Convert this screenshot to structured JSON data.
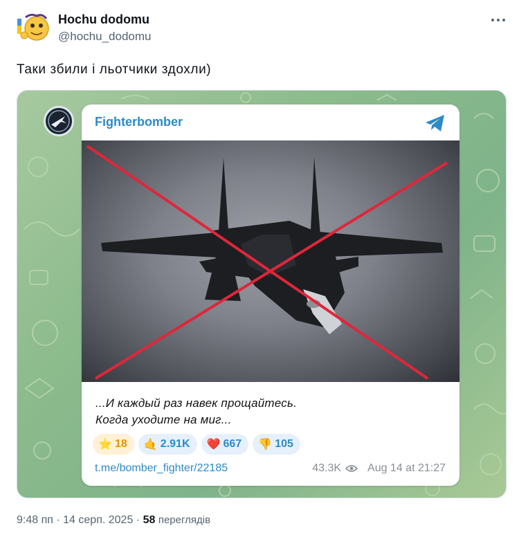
{
  "author": {
    "name": "Hochu dodomu",
    "handle": "@hochu_dodomu",
    "avatar_icon": "emoji-face-with-flag-icon"
  },
  "tweet": {
    "text": "Таки збили і льотчики здохли)"
  },
  "telegram_post": {
    "channel_name": "Fighterbomber",
    "channel_icon": "telegram-plane-icon",
    "caption_line1": "...И каждый раз навек прощайтесь.",
    "caption_line2": "Когда уходите на миг...",
    "reactions": [
      {
        "emoji": "⭐",
        "icon": "star-icon",
        "count": "18"
      },
      {
        "emoji": "🤙",
        "icon": "call-me-hand-icon",
        "count": "2.91K"
      },
      {
        "emoji": "❤️",
        "icon": "heart-icon",
        "count": "667"
      },
      {
        "emoji": "👎",
        "icon": "thumbs-down-icon",
        "count": "105"
      }
    ],
    "link": "t.me/bomber_fighter/22185",
    "views": "43.3K",
    "date": "Aug 14 at 21:27"
  },
  "footer": {
    "time": "9:48 пп",
    "date": "14 серп. 2025",
    "separator": "·",
    "views_count": "58",
    "views_label": "переглядів"
  },
  "colors": {
    "accent": "#2d8ac7",
    "cross": "#e0263a",
    "star_bg": "#fff1d6",
    "reaction_bg": "#e6f0fa"
  }
}
